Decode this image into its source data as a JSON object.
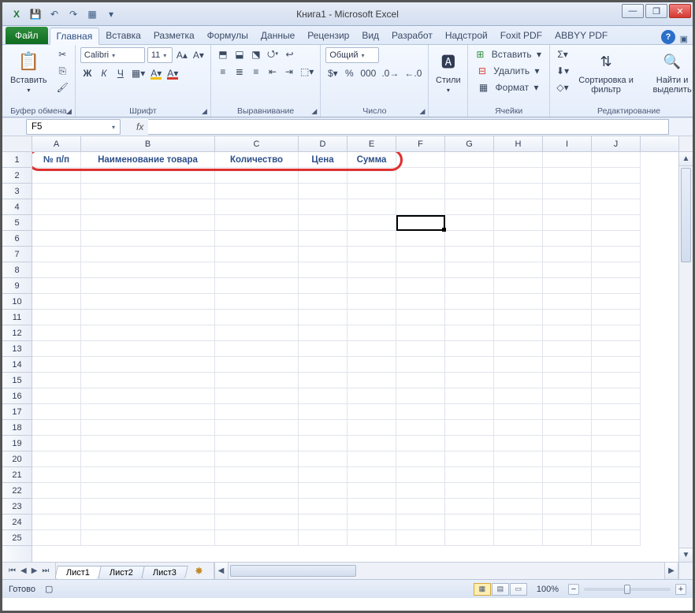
{
  "window": {
    "title": "Книга1 - Microsoft Excel"
  },
  "qat": {
    "excel": "X",
    "save": "💾",
    "undo": "↶",
    "redo": "↷",
    "touch": "▦",
    "more": "▾"
  },
  "tabs": {
    "file": "Файл",
    "items": [
      "Главная",
      "Вставка",
      "Разметка",
      "Формулы",
      "Данные",
      "Рецензир",
      "Вид",
      "Разработ",
      "Надстрой",
      "Foxit PDF",
      "ABBYY PDF"
    ],
    "activeIndex": 0
  },
  "ribbon": {
    "clipboard": {
      "paste": "Вставить",
      "label": "Буфер обмена"
    },
    "font": {
      "name": "Calibri",
      "size": "11",
      "bold": "Ж",
      "italic": "К",
      "underline": "Ч",
      "label": "Шрифт"
    },
    "alignment": {
      "label": "Выравнивание"
    },
    "number": {
      "format": "Общий",
      "label": "Число"
    },
    "styles": {
      "btn": "Стили",
      "label": ""
    },
    "cells": {
      "insert": "Вставить",
      "delete": "Удалить",
      "format": "Формат",
      "label": "Ячейки"
    },
    "editing": {
      "sort": "Сортировка и фильтр",
      "find": "Найти и выделить",
      "label": "Редактирование"
    }
  },
  "namebox": "F5",
  "columns": [
    "A",
    "B",
    "C",
    "D",
    "E",
    "F",
    "G",
    "H",
    "I",
    "J"
  ],
  "rowcount": 25,
  "headerRow": {
    "A": "№ п/п",
    "B": "Наименование товара",
    "C": "Количество",
    "D": "Цена",
    "E": "Сумма"
  },
  "sheets": {
    "items": [
      "Лист1",
      "Лист2",
      "Лист3"
    ],
    "activeIndex": 0
  },
  "status": {
    "ready": "Готово",
    "zoom": "100%"
  },
  "zoomControls": {
    "minus": "−",
    "plus": "+"
  },
  "activeCell": {
    "col": "F",
    "row": 5
  }
}
